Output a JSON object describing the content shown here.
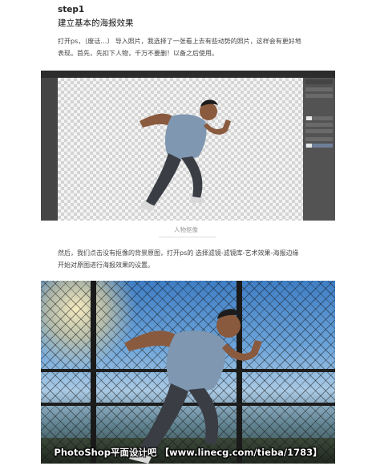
{
  "article": {
    "step_label": "step1",
    "heading": "建立基本的海报效果",
    "paragraph1_line1": "打开ps，〔废话…〕 导入照片，我选择了一张看上去有些动势的照片，这样会有更好地",
    "paragraph1_line2": "表现。首先，先扣下人物，千万不要删！以备之后使用。",
    "caption": "人物抠像",
    "paragraph2_line1": "然后，我们点击没有抠像的背景原图，打开ps的 选择滤镜-滤镜库-艺术效果-海报边缘",
    "paragraph2_line2": "开始对原图进行海报效果的设置。"
  },
  "watermark": "PhotoShop平面设计吧 【www.linecg.com/tieba/1783】",
  "icons": {
    "layers_panel": "photoshop-layers-panel-icon"
  },
  "colors": {
    "ps_background": "#3b3b3b",
    "ps_panel": "#535353",
    "selected_layer": "#6f7f9a",
    "sky": "#6ba3d9"
  }
}
